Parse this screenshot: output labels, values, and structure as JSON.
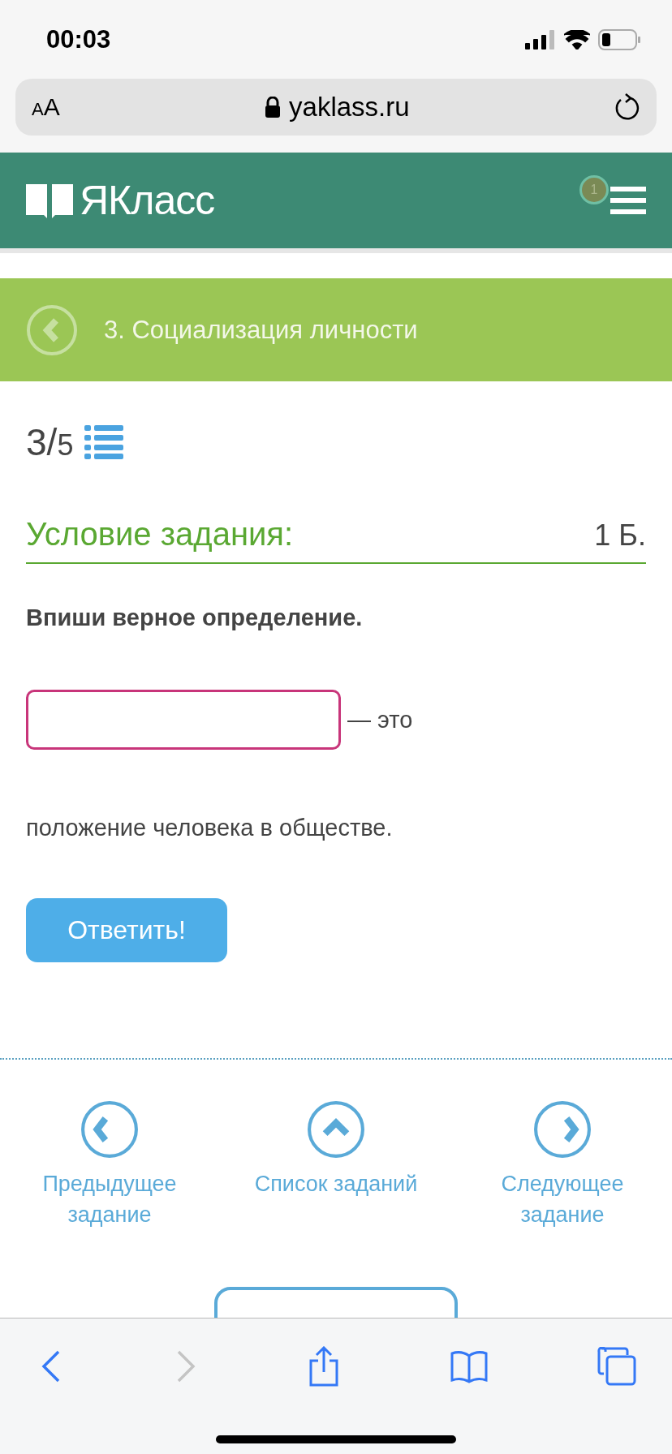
{
  "status_bar": {
    "time": "00:03"
  },
  "browser": {
    "text_size_button": "AA",
    "url": "yaklass.ru"
  },
  "header": {
    "logo": "ЯКласс",
    "notification_count": "1"
  },
  "topic_bar": {
    "title": "3. Социализация личности"
  },
  "progress": {
    "text": "3/5"
  },
  "task": {
    "heading": "Условие задания:",
    "points": "1 Б.",
    "instruction": "Впиши верное определение.",
    "answer_suffix": "— это",
    "continuation": "положение человека в обществе.",
    "submit": "Ответить!"
  },
  "navigation": [
    {
      "kind": "prev",
      "label": "Предыдущее задание"
    },
    {
      "kind": "list",
      "label": "Список заданий"
    },
    {
      "kind": "next",
      "label": "Следующее задание"
    }
  ],
  "browser_toolbar": {
    "back_enabled": true,
    "forward_enabled": false
  }
}
